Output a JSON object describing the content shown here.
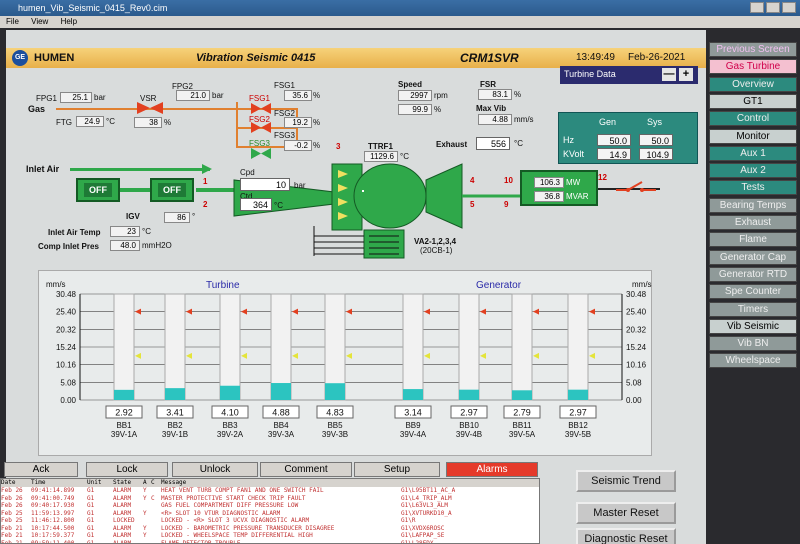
{
  "window": {
    "title": "humen_Vib_Seismic_0415_Rev0.cim",
    "menu": [
      "File",
      "View",
      "Help"
    ]
  },
  "header": {
    "logo": "GE",
    "org": "HUMEN",
    "title": "Vibration Seismic 0415",
    "unit": "CRM1SVR",
    "time": "13:49:49",
    "date": "Feb-26-2021"
  },
  "gas": {
    "label": "Gas",
    "fpg1_label": "FPG1",
    "fpg1": "25.1",
    "fpg1_unit": "bar",
    "ftg_label": "FTG",
    "ftg": "24.9",
    "ftg_unit": "°C",
    "fpg2_label": "FPG2",
    "fpg2": "21.0",
    "fpg2_unit": "bar",
    "vsr_label": "VSR",
    "vsr": "38",
    "vsr_unit": "%",
    "fsg1_label": "FSG1",
    "fsg1": "35.6",
    "fsg1_unit": "%",
    "fsg2_label": "FSG2",
    "fsg2": "19.2",
    "fsg2_unit": "%",
    "fsg3_label": "FSG3",
    "fsg3": "-0.2",
    "fsg3_unit": "%",
    "valve_fsg1": "FSG1",
    "valve_fsg2": "FSG2",
    "valve_fsg3": "FSG3"
  },
  "speed": {
    "label": "Speed",
    "rpm": "2997",
    "rpm_unit": "rpm",
    "pct": "99.9",
    "pct_unit": "%"
  },
  "fsr": {
    "label": "FSR",
    "value": "83.1",
    "unit": "%"
  },
  "maxvib": {
    "label": "Max Vib",
    "value": "4.88",
    "unit": "mm/s"
  },
  "exhaust": {
    "label": "Exhaust",
    "value": "556",
    "unit": "°C"
  },
  "ttrf1": {
    "label": "TTRF1",
    "value": "1129.6",
    "unit": "°C"
  },
  "inlet": {
    "air_label": "Inlet Air",
    "off1": "OFF",
    "off2": "OFF",
    "igv_label": "IGV",
    "igv": "86",
    "igv_unit": "°",
    "temp_label": "Inlet Air Temp",
    "temp": "23",
    "temp_unit": "°C",
    "pres_label": "Comp Inlet Pres",
    "pres": "48.0",
    "pres_unit": "mmH2O"
  },
  "compressor": {
    "cpd_label": "Cpd",
    "cpd": "10",
    "cpd_unit": "bar",
    "ctd_label": "Ctd",
    "ctd": "364",
    "ctd_unit": "°C"
  },
  "va_label": "VA2-1,2,3,4",
  "va_sub": "(20CB-1)",
  "gen_out": {
    "mw": "106.3",
    "mw_unit": "MW",
    "mvar": "36.8",
    "mvar_unit": "MVAR"
  },
  "numbers": [
    "1",
    "2",
    "3",
    "4",
    "5",
    "9",
    "10",
    "12"
  ],
  "turbine_select": {
    "label": "Turbine Data",
    "minus": "—",
    "plus": "+"
  },
  "hz_kv": {
    "gen": "Gen",
    "sys": "Sys",
    "hz": "Hz",
    "kv": "KVolt",
    "hz_gen": "50.0",
    "hz_sys": "50.0",
    "kv_gen": "14.9",
    "kv_sys": "104.9"
  },
  "chart_data": {
    "type": "bar",
    "unit_left": "mm/s",
    "unit_right": "mm/s",
    "section_turbine": "Turbine",
    "section_generator": "Generator",
    "ylim": [
      0,
      30.48
    ],
    "yticks": [
      "30.48",
      "25.40",
      "20.32",
      "15.24",
      "10.16",
      "5.08",
      "0.00"
    ],
    "alarm_level": 25.4,
    "warning_level": 12.7,
    "categories": [
      "BB1",
      "BB2",
      "BB3",
      "BB4",
      "BB5",
      "BB9",
      "BB10",
      "BB11",
      "BB12"
    ],
    "sublabels": [
      "39V-1A",
      "39V-1B",
      "39V-2A",
      "39V-3A",
      "39V-3B",
      "39V-4A",
      "39V-4B",
      "39V-5A",
      "39V-5B"
    ],
    "values": [
      2.92,
      3.41,
      4.1,
      4.88,
      4.83,
      3.14,
      2.97,
      2.79,
      2.97
    ],
    "value_labels": [
      "2.92",
      "3.41",
      "4.10",
      "4.88",
      "4.83",
      "3.14",
      "2.97",
      "2.79",
      "2.97"
    ]
  },
  "nav": [
    "Previous Screen",
    "Gas Turbine",
    "Overview",
    "GT1",
    "Control",
    "Monitor",
    "Aux 1",
    "Aux 2",
    "Tests",
    "Bearing Temps",
    "Exhaust",
    "Flame",
    "Generator Cap",
    "Generator RTD",
    "Spe Counter",
    "Timers",
    "Vib Seismic",
    "Vib BN",
    "Wheelspace"
  ],
  "buttons": {
    "ack": "Ack",
    "lock": "Lock",
    "unlock": "Unlock",
    "comment": "Comment",
    "setup": "Setup",
    "alarms": "Alarms",
    "seismic_trend": "Seismic Trend",
    "master_reset": "Master Reset",
    "diag_reset": "Diagnostic Reset"
  },
  "alarm_headers": [
    "Date",
    "Time",
    "Unit",
    "State",
    "A",
    "C",
    "Message"
  ],
  "alarms": [
    [
      "Feb 26",
      "09:41:14.899",
      "G1",
      "ALARM",
      "Y",
      "",
      "HEAT VENT TURB COMPT FAN1 AND ONE SWITCH FAIL",
      "G1\\L95BT11_AC_A"
    ],
    [
      "Feb 26",
      "09:41:00.749",
      "G1",
      "ALARM",
      "Y",
      "C",
      "MASTER PROTECTIVE START CHECK TRIP FAULT",
      "G1\\L4_TRIP_ALM"
    ],
    [
      "Feb 26",
      "09:40:17.930",
      "G1",
      "ALARM",
      "",
      "",
      "GAS FUEL COMPARTMENT DIFF PRESSURE LOW",
      "G1\\L63VL3_ALM"
    ],
    [
      "Feb 25",
      "11:59:13.997",
      "G1",
      "ALARM",
      "Y",
      "",
      "<R> SLOT 10 VTUR DIAGNOSTIC ALARM",
      "G1\\XVTURKD10_A"
    ],
    [
      "Feb 25",
      "11:46:12.800",
      "G1",
      "LOCKED",
      "",
      "",
      "LOCKED - <R> SLOT 3 UCVX DIAGNOSTIC ALARM",
      "G1\\R"
    ],
    [
      "Feb 21",
      "10:17:44.500",
      "G1",
      "ALARM",
      "Y",
      "",
      "LOCKED - BAROMETRIC PRESSURE TRANSDUCER DISAGREE",
      "G1\\XVDX6ROSC"
    ],
    [
      "Feb 21",
      "10:17:59.377",
      "G1",
      "ALARM",
      "Y",
      "",
      "LOCKED - WHEELSPACE TEMP DIFFERENTIAL HIGH",
      "G1\\LAFPAP_SE"
    ],
    [
      "Feb 21",
      "09:59:11.400",
      "G1",
      "ALARM",
      "",
      "",
      "FLAME DETECTOR TROUBLE",
      "G1\\L28FDX"
    ]
  ],
  "colors": {
    "teal": "#2c8a7e",
    "green": "#2fa84a",
    "orange": "#e08030",
    "alarm_red": "#e53a2a",
    "bar_fill": "#2cc4c0",
    "alarm_arrow": "#e24020",
    "warn_arrow": "#e4e43a"
  }
}
